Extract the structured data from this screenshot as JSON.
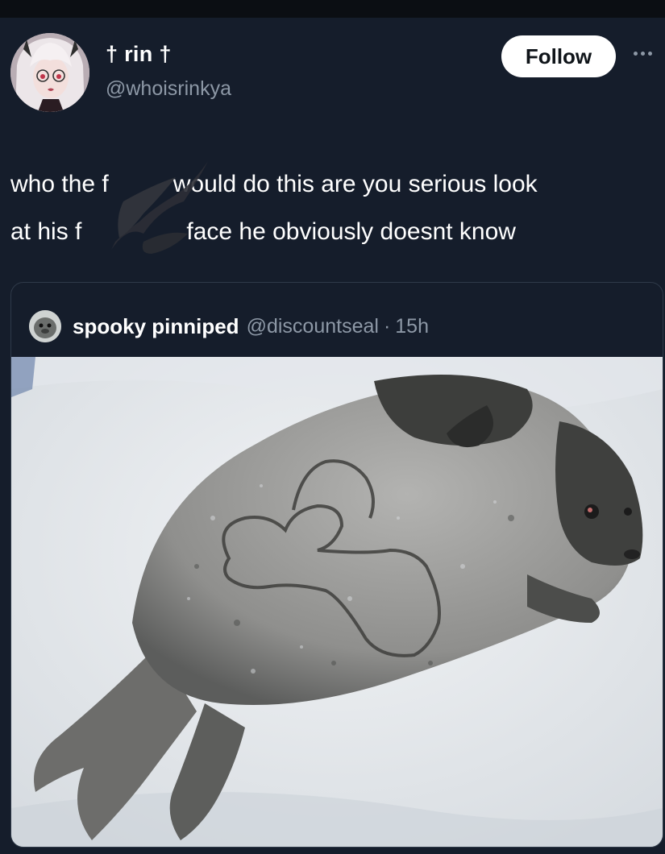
{
  "post": {
    "author": {
      "display_name": "† rin †",
      "handle": "@whoisrinkya",
      "avatar_icon": "anime-avatar-icon"
    },
    "follow_label": "Follow",
    "more_icon": "more-options-icon",
    "text_line1_a": "who the f",
    "text_line1_b": "would do this are you serious look",
    "text_line2_a": "at his f",
    "text_line2_b": "face he obviously doesnt know"
  },
  "quote": {
    "author_name": "spooky pinniped",
    "handle": "@discountseal",
    "separator": "·",
    "time": "15h",
    "avatar_icon": "seal-avatar-icon",
    "image_icon": "seal-in-snow-photo"
  },
  "colors": {
    "background": "#151d2b",
    "text_primary": "#ffffff",
    "text_secondary": "#8d98a6",
    "border": "#2f3a49",
    "follow_bg": "#ffffff"
  }
}
